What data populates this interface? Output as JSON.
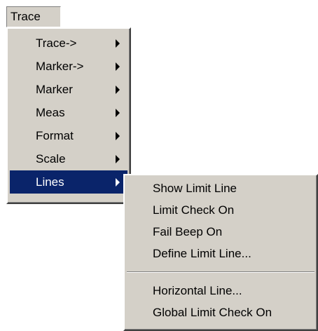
{
  "menubar": {
    "trace_label": "Trace"
  },
  "trace_menu": {
    "items": [
      {
        "label": "Trace->",
        "has_submenu": true
      },
      {
        "label": "Marker->",
        "has_submenu": true
      },
      {
        "label": "Marker",
        "has_submenu": true
      },
      {
        "label": "Meas",
        "has_submenu": true
      },
      {
        "label": "Format",
        "has_submenu": true
      },
      {
        "label": "Scale",
        "has_submenu": true
      },
      {
        "label": "Lines",
        "has_submenu": true,
        "highlighted": true
      }
    ]
  },
  "lines_submenu": {
    "group1": [
      {
        "label": "Show Limit Line"
      },
      {
        "label": "Limit Check On"
      },
      {
        "label": "Fail Beep On"
      },
      {
        "label": "Define Limit Line..."
      }
    ],
    "group2": [
      {
        "label": "Horizontal Line..."
      },
      {
        "label": "Global Limit Check On"
      }
    ]
  },
  "colors": {
    "menu_background": "#d4d0c8",
    "highlight_background": "#0a246a",
    "highlight_text": "#ffffff"
  },
  "icons": {
    "submenu_arrow": "chevron-right-icon"
  }
}
